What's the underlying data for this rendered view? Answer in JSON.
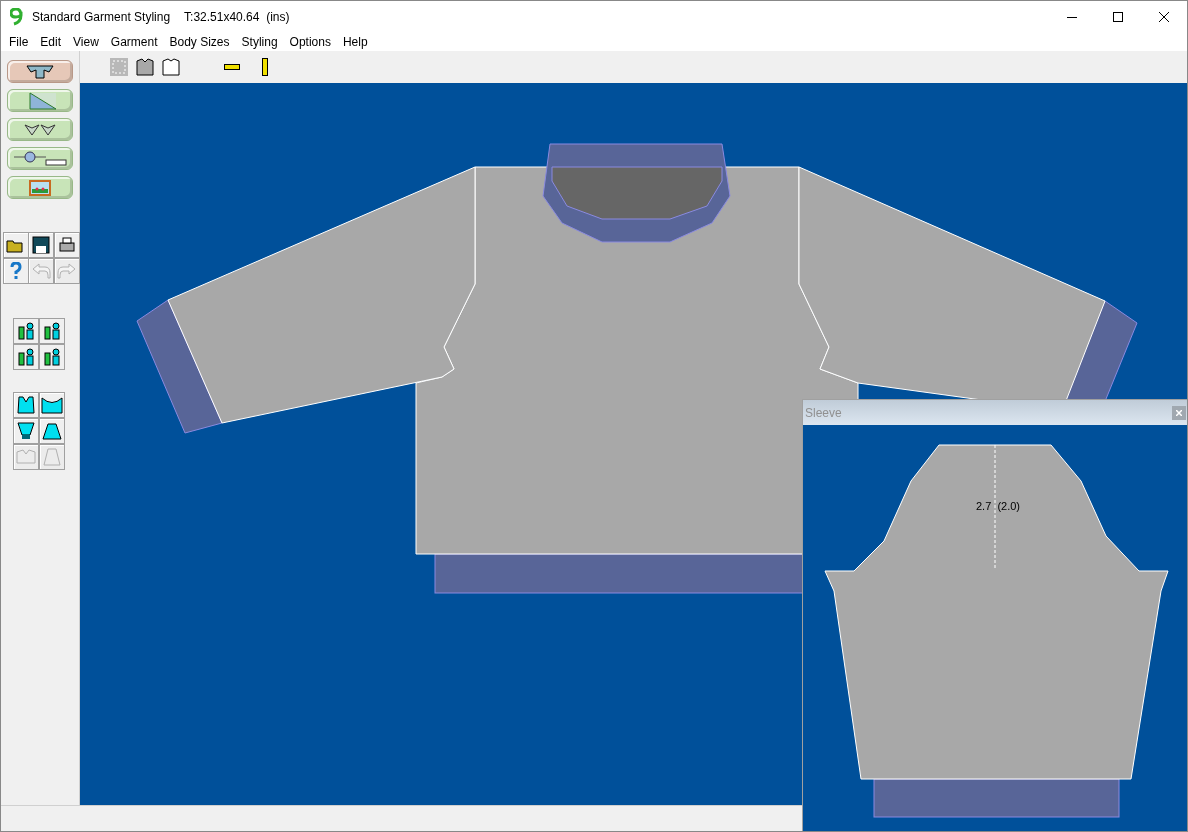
{
  "window": {
    "title": "Standard Garment Styling",
    "measure": "T:32.51x40.64  (ins)"
  },
  "menu": [
    "File",
    "Edit",
    "View",
    "Garment",
    "Body Sizes",
    "Styling",
    "Options",
    "Help"
  ],
  "modes": [
    {
      "kind": "garment",
      "selected": true
    },
    {
      "kind": "chart",
      "selected": false
    },
    {
      "kind": "pieces",
      "selected": false
    },
    {
      "kind": "knit",
      "selected": false
    },
    {
      "kind": "picture",
      "selected": false
    }
  ],
  "file_tools": [
    {
      "kind": "open",
      "disabled": false
    },
    {
      "kind": "save",
      "disabled": false
    },
    {
      "kind": "print",
      "disabled": false
    },
    {
      "kind": "help",
      "disabled": false
    },
    {
      "kind": "undo",
      "disabled": true
    },
    {
      "kind": "redo",
      "disabled": true
    }
  ],
  "shape_tools": [
    {
      "kind": "front",
      "disabled": false
    },
    {
      "kind": "back",
      "disabled": false
    },
    {
      "kind": "sleeve",
      "disabled": false
    },
    {
      "kind": "cap",
      "disabled": false
    },
    {
      "kind": "collar",
      "disabled": true
    },
    {
      "kind": "skirt",
      "disabled": true
    }
  ],
  "sleeve_window": {
    "title": "Sleeve",
    "measurement": "2.7  (2.0)"
  }
}
